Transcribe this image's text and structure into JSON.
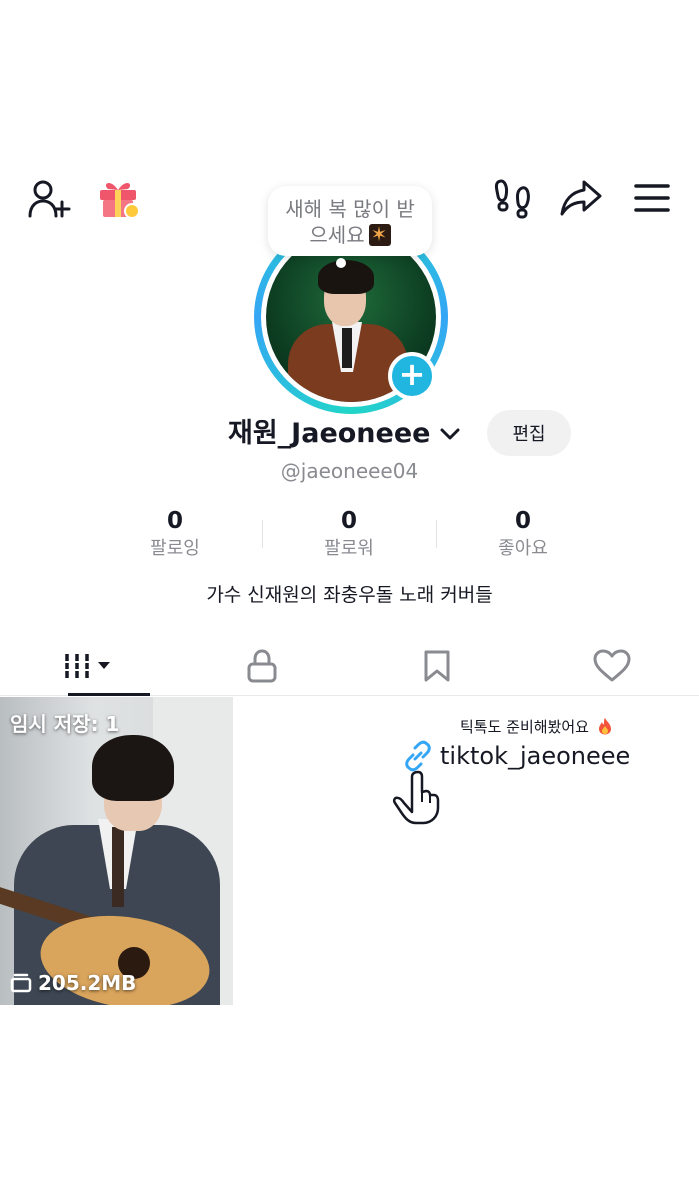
{
  "topbar": {
    "add_friend_icon": "add-user-icon",
    "gift_icon": "gift-icon",
    "footprint_icon": "footprint-icon",
    "share_icon": "share-icon",
    "menu_icon": "menu-icon"
  },
  "note": {
    "text_line1": "새해 복 많이 받",
    "text_line2": "으세요"
  },
  "profile": {
    "display_name": "재원_Jaeoneee",
    "edit_label": "편집",
    "username": "@jaeoneee04",
    "bio": "가수 신재원의 좌충우돌 노래 커버들"
  },
  "stats": [
    {
      "value": "0",
      "label": "팔로잉"
    },
    {
      "value": "0",
      "label": "팔로워"
    },
    {
      "value": "0",
      "label": "좋아요"
    }
  ],
  "tabs": [
    "videos-grid",
    "private",
    "saved",
    "liked"
  ],
  "drafts": {
    "label": "임시 저장: 1",
    "size": "205.2MB"
  },
  "annotation": {
    "caption": "틱톡도 준비해봤어요",
    "link_text": "tiktok_jaeoneee"
  },
  "colors": {
    "accent": "#20b6e0",
    "ring_start": "#21d6c7",
    "ring_end": "#35a6f5",
    "text_primary": "#161823",
    "text_secondary": "#8a8b91"
  }
}
